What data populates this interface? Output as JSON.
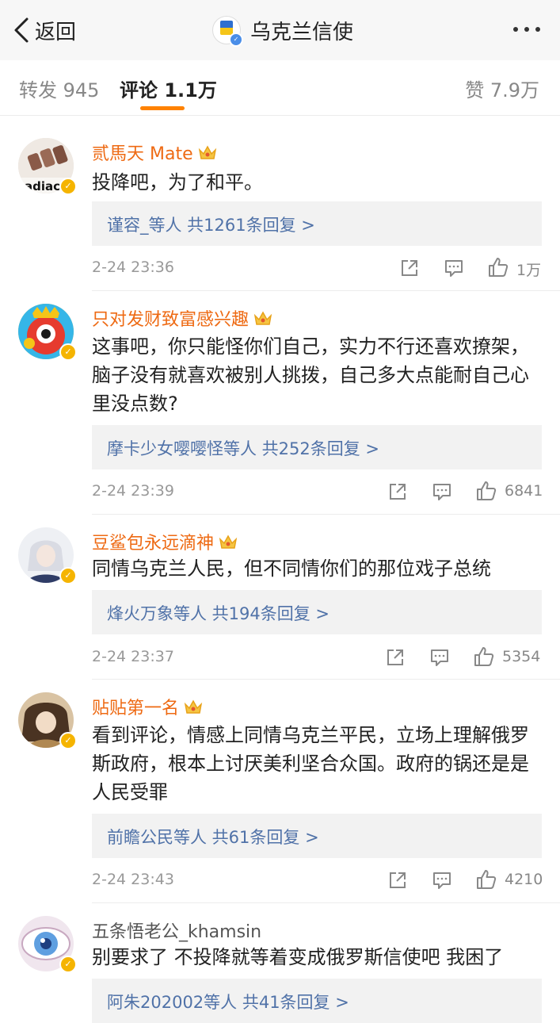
{
  "header": {
    "back_label": "返回",
    "title": "乌克兰信使"
  },
  "tabs": {
    "repost": "转发 945",
    "comment": "评论 1.1万",
    "like": "赞 7.9万"
  },
  "colors": {
    "accent": "#ff8200",
    "username": "#ee6a13",
    "link": "#5072a8",
    "verified": "#f5b400"
  },
  "comments": [
    {
      "username": "贰馬天 Mate",
      "text": "投降吧，为了和平。",
      "replies": "谨容_等人  共1261条回复 >",
      "time": "2-24 23:36",
      "likes": "1万"
    },
    {
      "username": "只对发财致富感兴趣",
      "text": "这事吧，你只能怪你们自己，实力不行还喜欢撩架，脑子没有就喜欢被别人挑拨，自己多大点能耐自己心里没点数?",
      "replies": "摩卡少女嘤嘤怪等人  共252条回复 >",
      "time": "2-24 23:39",
      "likes": "6841"
    },
    {
      "username": "豆鲨包永远滴神",
      "text": "同情乌克兰人民，但不同情你们的那位戏子总统",
      "replies": "烽火万象等人  共194条回复 >",
      "time": "2-24 23:37",
      "likes": "5354"
    },
    {
      "username": "贴贴第一名",
      "text": "看到评论，情感上同情乌克兰平民，立场上理解俄罗斯政府，根本上讨厌美利坚合众国。政府的锅还是是人民受罪",
      "replies": "前瞻公民等人  共61条回复 >",
      "time": "2-24 23:43",
      "likes": "4210"
    },
    {
      "username": "五条悟老公_khamsin",
      "text": "别要求了 不投降就等着变成俄罗斯信使吧 我困了",
      "replies": "阿朱202002等人  共41条回复 >"
    }
  ]
}
